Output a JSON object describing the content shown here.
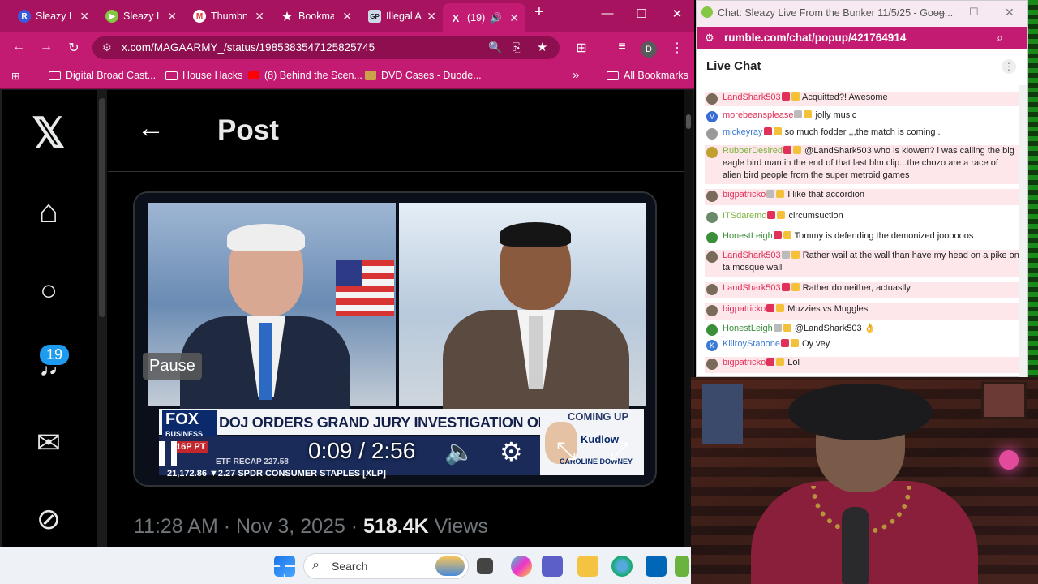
{
  "browser": {
    "tabs": [
      {
        "label": "Sleazy L",
        "fav_color": "#3a5bd9",
        "fav_letter": "R"
      },
      {
        "label": "Sleazy L",
        "fav_color": "#85c742",
        "fav_letter": "▶"
      },
      {
        "label": "Thumbn",
        "fav_color": "#ffffff",
        "fav_letter": "M"
      },
      {
        "label": "Bookma",
        "fav_color": "#ffffff",
        "fav_letter": "★"
      },
      {
        "label": "Illegal A",
        "fav_color": "#cfd8e6",
        "fav_letter": "GP"
      },
      {
        "label": "(19)",
        "fav_color": "#000000",
        "fav_letter": "X"
      }
    ],
    "new_tab": "+",
    "url": "x.com/MAGAARMY_/status/1985383547125825745",
    "profile_initial": "D",
    "bookmarks": [
      {
        "label": "Digital Broad Cast..."
      },
      {
        "label": "House Hacks"
      },
      {
        "label": "(8) Behind the Scen..."
      },
      {
        "label": "DVD Cases - Duode..."
      }
    ],
    "more_bookmarks": "»",
    "all_bookmarks": "All Bookmarks"
  },
  "x": {
    "page_title": "Post",
    "notification_badge": "19",
    "video": {
      "tooltip": "Pause",
      "time": "0:09 / 2:56",
      "chyron": "DOJ ORDERS GRAND JURY INVESTIGATION ON RUSSIAGATE",
      "network_logo": "FOX",
      "network_sub": "BUSINESS",
      "ptime": "16P PT",
      "ticker": "21,172.86  ▼2.27  SPDR CONSUMER STAPLES [XLP]",
      "ticker2": "ETF RECAP  227.58",
      "coming_up": "COMING UP",
      "coming_up_show": "Kudlow",
      "coming_up_name": "CAROLINE DOWNEY"
    },
    "meta": {
      "time": "11:28 AM · Nov 3, 2025 · ",
      "views": "518.4K",
      "views_label": " Views"
    }
  },
  "taskbar": {
    "search_placeholder": "Search"
  },
  "chat": {
    "window_title": "Chat: Sleazy Live From the Bunker 11/5/25 - Goog...",
    "url": "rumble.com/chat/popup/421764914",
    "header": "Live Chat",
    "messages": [
      {
        "user": "LandShark503",
        "text": "Acquitted?! Awesome",
        "color": "#e0315a",
        "highlight": true,
        "initial": ""
      },
      {
        "user": "morebeansplease",
        "text": "jolly music",
        "color": "#e0315a",
        "highlight": false,
        "initial": "M"
      },
      {
        "user": "mickeyray",
        "text": "so much fodder ,,,the match is coming .",
        "color": "#3a7bd5",
        "highlight": false,
        "initial": ""
      },
      {
        "user": "RubberDesired",
        "text": "@LandShark503 who is klowen? i was calling the big eagle bird man in the end of that last blm clip...the chozo are a race of alien bird people from the super metroid games",
        "color": "#7bb33b",
        "highlight": true,
        "initial": ""
      },
      {
        "user": "bigpatricko",
        "text": "I like that accordion",
        "color": "#e0315a",
        "highlight": true,
        "initial": ""
      },
      {
        "user": "ITSdaremo",
        "text": "circumsuction",
        "color": "#7bb33b",
        "highlight": false,
        "initial": ""
      },
      {
        "user": "HonestLeigh",
        "text": "Tommy is defending the demonized joooooos",
        "color": "#3b8f3b",
        "highlight": false,
        "initial": ""
      },
      {
        "user": "LandShark503",
        "text": "Rather wail at the wall than have my head on a pike on ta mosque wall",
        "color": "#e0315a",
        "highlight": true,
        "initial": ""
      },
      {
        "user": "LandShark503",
        "text": "Rather do neither, actuaslly",
        "color": "#e0315a",
        "highlight": true,
        "initial": ""
      },
      {
        "user": "bigpatricko",
        "text": "Muzzies vs Muggles",
        "color": "#e0315a",
        "highlight": true,
        "initial": ""
      },
      {
        "user": "HonestLeigh",
        "text": "@LandShark503 👌",
        "color": "#3b8f3b",
        "highlight": false,
        "initial": ""
      },
      {
        "user": "KillroyStabone",
        "text": "Oy vey",
        "color": "#3a7bd5",
        "highlight": false,
        "initial": "K"
      },
      {
        "user": "bigpatricko",
        "text": "Lol",
        "color": "#e0315a",
        "highlight": true,
        "initial": ""
      }
    ]
  }
}
